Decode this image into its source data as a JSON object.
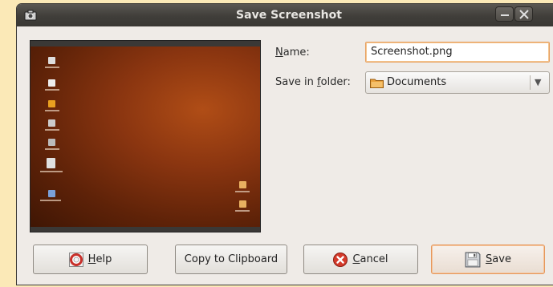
{
  "window": {
    "title": "Save Screenshot"
  },
  "form": {
    "name_label_mnemonic": "N",
    "name_label_rest": "ame:",
    "name_value": "Screenshot.png",
    "folder_label_prefix": "Save in ",
    "folder_label_mnemonic": "f",
    "folder_label_rest": "older:",
    "folder_value": "Documents"
  },
  "buttons": {
    "help_mnemonic": "H",
    "help_rest": "elp",
    "copy_label": "Copy to Clipboard",
    "cancel_mnemonic": "C",
    "cancel_rest": "ancel",
    "save_mnemonic": "S",
    "save_rest": "ave"
  },
  "icons": {
    "app": "camera-icon",
    "folder": "folder-icon",
    "help": "help-lifebuoy-icon",
    "cancel": "cancel-icon",
    "save": "floppy-disk-icon"
  },
  "colors": {
    "page_background": "#fbe9b7",
    "titlebar": "#403e3a",
    "focus_accent": "#e6975a",
    "preview_wallpaper": "#8a3510"
  }
}
